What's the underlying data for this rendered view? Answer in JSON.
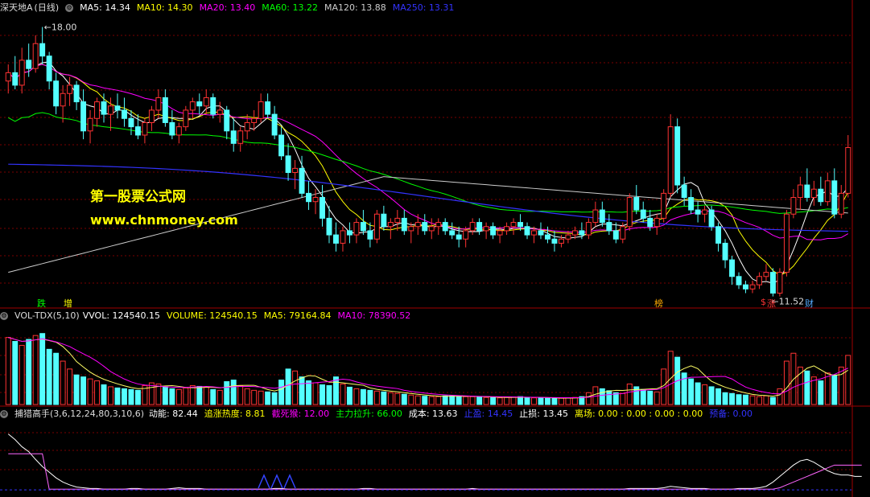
{
  "main": {
    "stock_name": "深天地A",
    "period": "(日线)",
    "ma": [
      {
        "label": "MA5",
        "value": "14.34",
        "color": "#ffffff"
      },
      {
        "label": "MA10",
        "value": "14.30",
        "color": "#ffff00"
      },
      {
        "label": "MA20",
        "value": "13.40",
        "color": "#ff00ff"
      },
      {
        "label": "MA60",
        "value": "13.22",
        "color": "#00ff00"
      },
      {
        "label": "MA120",
        "value": "13.88",
        "color": "#cccccc"
      },
      {
        "label": "MA250",
        "value": "13.31",
        "color": "#3333ff"
      }
    ],
    "high_marker": "18.00",
    "low_marker": "11.52",
    "watermark_cn": "第一股票公式网",
    "watermark_url": "www.chnmoney.com",
    "tags": [
      {
        "text": "跌",
        "color": "#00ff00"
      },
      {
        "text": "增",
        "color": "#ffff00"
      },
      {
        "text": "榜",
        "color": "#ffaa00"
      },
      {
        "text": "$",
        "color": "#ff3333"
      },
      {
        "text": "涨",
        "color": "#ff3333"
      },
      {
        "text": "财",
        "color": "#55aaff"
      }
    ]
  },
  "vol": {
    "title": "VOL-TDX(5,10)",
    "items": [
      {
        "label": "VVOL:",
        "value": "124540.15",
        "color": "#ffffff"
      },
      {
        "label": "VOLUME:",
        "value": "124540.15",
        "color": "#ffff00"
      },
      {
        "label": "MA5:",
        "value": "79164.84",
        "color": "#ffff00"
      },
      {
        "label": "MA10:",
        "value": "78390.52",
        "color": "#ff00ff"
      }
    ]
  },
  "ind": {
    "title": "捕猎高手(3,6,12,24,80,3,10,6)",
    "items": [
      {
        "label": "动能:",
        "value": "82.44",
        "color": "#ffffff"
      },
      {
        "label": "追涨热度:",
        "value": "8.81",
        "color": "#ffff00"
      },
      {
        "label": "截死猴:",
        "value": "12.00",
        "color": "#ff00ff"
      },
      {
        "label": "主力拉升:",
        "value": "66.00",
        "color": "#00ff00"
      },
      {
        "label": "成本:",
        "value": "13.63",
        "color": "#ffffff"
      },
      {
        "label": "止盈:",
        "value": "14.45",
        "color": "#3333ff"
      },
      {
        "label": "止损:",
        "value": "13.45",
        "color": "#ffffff"
      },
      {
        "label": "离场:",
        "value": "0.00 : 0.00 : 0.00 : 0.00",
        "color": "#ffff00"
      },
      {
        "label": "预备:",
        "value": "0.00",
        "color": "#3333ff"
      }
    ]
  },
  "chart_data": [
    {
      "type": "candlestick",
      "title": "深天地A (日线)",
      "ylim": [
        11.3,
        18.3
      ],
      "up_color": "#ff3333",
      "down_color": "#54ffff",
      "candles": [
        [
          16.7,
          17.1,
          16.4,
          16.9
        ],
        [
          16.9,
          17.3,
          16.5,
          16.6
        ],
        [
          16.6,
          17.5,
          16.4,
          17.2
        ],
        [
          17.2,
          17.6,
          16.8,
          17.0
        ],
        [
          17.0,
          17.8,
          16.9,
          17.6
        ],
        [
          17.6,
          18.0,
          17.1,
          17.3
        ],
        [
          17.3,
          17.4,
          16.5,
          16.7
        ],
        [
          16.7,
          16.9,
          15.9,
          16.1
        ],
        [
          16.1,
          16.6,
          15.7,
          16.4
        ],
        [
          16.4,
          16.8,
          16.1,
          16.6
        ],
        [
          16.6,
          16.7,
          16.0,
          16.2
        ],
        [
          16.2,
          16.5,
          15.3,
          15.5
        ],
        [
          15.5,
          16.0,
          15.2,
          15.8
        ],
        [
          15.8,
          16.3,
          15.6,
          16.2
        ],
        [
          16.2,
          16.4,
          15.7,
          15.9
        ],
        [
          15.9,
          16.3,
          15.5,
          16.1
        ],
        [
          16.1,
          16.4,
          15.8,
          16.0
        ],
        [
          16.0,
          16.3,
          15.6,
          15.8
        ],
        [
          15.8,
          16.0,
          15.4,
          15.6
        ],
        [
          15.6,
          15.9,
          15.3,
          15.4
        ],
        [
          15.4,
          15.8,
          15.2,
          15.7
        ],
        [
          15.7,
          16.1,
          15.5,
          16.0
        ],
        [
          16.0,
          16.5,
          15.8,
          16.3
        ],
        [
          16.3,
          16.5,
          15.6,
          15.7
        ],
        [
          15.7,
          16.0,
          15.3,
          15.4
        ],
        [
          15.4,
          15.7,
          15.2,
          15.6
        ],
        [
          15.6,
          16.1,
          15.5,
          16.0
        ],
        [
          16.0,
          16.3,
          15.8,
          16.2
        ],
        [
          16.2,
          16.4,
          15.9,
          16.1
        ],
        [
          16.1,
          16.5,
          15.9,
          16.3
        ],
        [
          16.3,
          16.4,
          15.8,
          15.9
        ],
        [
          15.9,
          16.2,
          15.7,
          16.0
        ],
        [
          16.0,
          16.1,
          15.3,
          15.5
        ],
        [
          15.5,
          15.8,
          15.0,
          15.2
        ],
        [
          15.2,
          15.6,
          15.0,
          15.5
        ],
        [
          15.5,
          15.9,
          15.3,
          15.7
        ],
        [
          15.7,
          16.0,
          15.5,
          15.8
        ],
        [
          15.8,
          16.4,
          15.7,
          16.2
        ],
        [
          16.2,
          16.4,
          15.8,
          15.9
        ],
        [
          15.9,
          16.1,
          15.3,
          15.4
        ],
        [
          15.4,
          15.6,
          14.8,
          14.9
        ],
        [
          14.9,
          15.2,
          14.3,
          14.5
        ],
        [
          14.5,
          14.8,
          14.1,
          14.6
        ],
        [
          14.6,
          14.9,
          13.9,
          14.0
        ],
        [
          14.0,
          14.3,
          13.6,
          13.8
        ],
        [
          13.8,
          14.1,
          13.5,
          13.9
        ],
        [
          13.9,
          14.2,
          13.2,
          13.4
        ],
        [
          13.4,
          13.7,
          12.8,
          13.0
        ],
        [
          13.0,
          13.3,
          12.6,
          12.8
        ],
        [
          12.8,
          13.2,
          12.6,
          13.1
        ],
        [
          13.1,
          13.3,
          12.8,
          13.0
        ],
        [
          13.0,
          13.4,
          12.8,
          13.3
        ],
        [
          13.3,
          13.6,
          13.0,
          13.1
        ],
        [
          13.1,
          13.3,
          12.7,
          12.9
        ],
        [
          12.9,
          13.6,
          12.8,
          13.5
        ],
        [
          13.5,
          13.7,
          13.1,
          13.2
        ],
        [
          13.2,
          13.4,
          12.9,
          13.3
        ],
        [
          13.3,
          13.6,
          13.1,
          13.4
        ],
        [
          13.4,
          13.6,
          13.0,
          13.1
        ],
        [
          13.1,
          13.3,
          12.8,
          13.2
        ],
        [
          13.2,
          13.5,
          13.0,
          13.3
        ],
        [
          13.3,
          13.5,
          13.0,
          13.1
        ],
        [
          13.1,
          13.4,
          12.9,
          13.2
        ],
        [
          13.2,
          13.4,
          13.0,
          13.3
        ],
        [
          13.3,
          13.4,
          13.0,
          13.1
        ],
        [
          13.1,
          13.3,
          12.9,
          13.0
        ],
        [
          13.0,
          13.2,
          12.7,
          12.9
        ],
        [
          12.9,
          13.2,
          12.7,
          13.1
        ],
        [
          13.1,
          13.4,
          13.0,
          13.3
        ],
        [
          13.3,
          13.4,
          13.0,
          13.1
        ],
        [
          13.1,
          13.3,
          12.9,
          13.2
        ],
        [
          13.2,
          13.3,
          12.9,
          13.0
        ],
        [
          13.0,
          13.2,
          12.8,
          13.1
        ],
        [
          13.1,
          13.3,
          13.0,
          13.2
        ],
        [
          13.2,
          13.4,
          13.0,
          13.3
        ],
        [
          13.3,
          13.5,
          13.1,
          13.2
        ],
        [
          13.2,
          13.3,
          12.9,
          13.0
        ],
        [
          13.0,
          13.2,
          12.8,
          13.1
        ],
        [
          13.1,
          13.3,
          12.9,
          13.0
        ],
        [
          13.0,
          13.2,
          12.8,
          12.9
        ],
        [
          12.9,
          13.1,
          12.6,
          12.8
        ],
        [
          12.8,
          13.0,
          12.7,
          12.9
        ],
        [
          12.9,
          13.1,
          12.8,
          13.0
        ],
        [
          13.0,
          13.2,
          12.9,
          13.1
        ],
        [
          13.1,
          13.3,
          12.9,
          13.0
        ],
        [
          13.0,
          13.4,
          12.9,
          13.3
        ],
        [
          13.3,
          13.8,
          13.2,
          13.6
        ],
        [
          13.6,
          13.8,
          13.2,
          13.3
        ],
        [
          13.3,
          13.5,
          13.0,
          13.1
        ],
        [
          13.1,
          13.3,
          12.8,
          12.9
        ],
        [
          12.9,
          13.3,
          12.8,
          13.2
        ],
        [
          13.2,
          14.0,
          13.1,
          13.9
        ],
        [
          13.9,
          14.2,
          13.5,
          13.6
        ],
        [
          13.6,
          13.8,
          13.3,
          13.4
        ],
        [
          13.4,
          13.6,
          13.1,
          13.2
        ],
        [
          13.2,
          13.5,
          13.0,
          13.4
        ],
        [
          13.4,
          14.1,
          13.3,
          14.0
        ],
        [
          14.0,
          15.9,
          13.9,
          15.6
        ],
        [
          15.6,
          15.8,
          14.0,
          14.2
        ],
        [
          14.2,
          14.4,
          13.7,
          13.9
        ],
        [
          13.9,
          14.1,
          13.5,
          13.6
        ],
        [
          13.6,
          13.8,
          13.3,
          13.5
        ],
        [
          13.5,
          13.7,
          13.3,
          13.6
        ],
        [
          13.6,
          13.7,
          13.1,
          13.2
        ],
        [
          13.2,
          13.3,
          12.6,
          12.8
        ],
        [
          12.8,
          12.9,
          12.2,
          12.4
        ],
        [
          12.4,
          12.5,
          11.8,
          12.0
        ],
        [
          12.0,
          12.1,
          11.7,
          11.8
        ],
        [
          11.8,
          11.9,
          11.6,
          11.7
        ],
        [
          11.7,
          11.9,
          11.6,
          11.8
        ],
        [
          11.8,
          12.1,
          11.7,
          12.0
        ],
        [
          12.0,
          12.3,
          11.9,
          12.1
        ],
        [
          12.1,
          12.2,
          11.52,
          11.6
        ],
        [
          11.6,
          12.2,
          11.52,
          12.1
        ],
        [
          12.1,
          13.6,
          12.0,
          13.5
        ],
        [
          13.5,
          14.1,
          13.4,
          13.9
        ],
        [
          13.9,
          14.4,
          13.6,
          14.2
        ],
        [
          14.2,
          14.6,
          13.8,
          13.9
        ],
        [
          13.9,
          14.3,
          13.7,
          14.1
        ],
        [
          14.1,
          14.4,
          13.7,
          13.8
        ],
        [
          13.8,
          14.5,
          13.7,
          14.3
        ],
        [
          14.3,
          14.6,
          13.4,
          13.5
        ],
        [
          13.5,
          14.2,
          13.4,
          14.0
        ],
        [
          14.0,
          15.4,
          13.9,
          15.1
        ]
      ]
    },
    {
      "type": "bar",
      "title": "VOL-TDX(5,10)",
      "ylim": [
        0,
        210000
      ],
      "values": [
        170000,
        160000,
        150000,
        165000,
        175000,
        180000,
        140000,
        130000,
        110000,
        90000,
        75000,
        70000,
        65000,
        60000,
        50000,
        45000,
        42000,
        40000,
        38000,
        36000,
        48000,
        55000,
        52000,
        45000,
        40000,
        38000,
        42000,
        48000,
        46000,
        44000,
        38000,
        36000,
        58000,
        62000,
        48000,
        40000,
        36000,
        34000,
        32000,
        30000,
        62000,
        90000,
        85000,
        70000,
        60000,
        55000,
        50000,
        48000,
        70000,
        52000,
        44000,
        40000,
        38000,
        36000,
        34000,
        32000,
        30000,
        28000,
        26000,
        24000,
        22000,
        21000,
        20000,
        20000,
        22000,
        22000,
        21000,
        20000,
        20000,
        19000,
        18000,
        18000,
        17000,
        18000,
        19000,
        20000,
        18000,
        17000,
        17000,
        16000,
        16000,
        16000,
        17000,
        18000,
        20000,
        30000,
        45000,
        40000,
        35000,
        30000,
        28000,
        52000,
        45000,
        38000,
        34000,
        32000,
        90000,
        135000,
        120000,
        80000,
        65000,
        55000,
        50000,
        45000,
        40000,
        30000,
        28000,
        25000,
        24000,
        22000,
        20000,
        22000,
        18000,
        40000,
        110000,
        130000,
        95000,
        85000,
        70000,
        60000,
        80000,
        75000,
        95000,
        124540
      ]
    },
    {
      "type": "line",
      "title": "捕猎高手(3,6,12,24,80,3,10,6)",
      "series": [
        {
          "name": "动能",
          "values": [
            80,
            72,
            62,
            55,
            44,
            34,
            26,
            18,
            12,
            8,
            5,
            4,
            3,
            3,
            2,
            2,
            2,
            2,
            3,
            3,
            2,
            2,
            2,
            2,
            3,
            4,
            3,
            3,
            3,
            2,
            2,
            2,
            2,
            2,
            2,
            2,
            2,
            2,
            2,
            3,
            3,
            2,
            2,
            2,
            2,
            2,
            2,
            2,
            2,
            2,
            2,
            2,
            3,
            3,
            2,
            2,
            2,
            2,
            2,
            2,
            2,
            2,
            2,
            2,
            2,
            2,
            2,
            2,
            3,
            2,
            2,
            2,
            2,
            2,
            2,
            2,
            2,
            2,
            2,
            2,
            2,
            2,
            2,
            2,
            2,
            2,
            2,
            2,
            2,
            2,
            2,
            3,
            3,
            3,
            3,
            3,
            4,
            6,
            5,
            4,
            3,
            3,
            3,
            2,
            2,
            2,
            2,
            3,
            3,
            3,
            4,
            6,
            12,
            20,
            28,
            36,
            42,
            44,
            40,
            34,
            28,
            24,
            22,
            22,
            20,
            20
          ]
        }
      ]
    }
  ]
}
